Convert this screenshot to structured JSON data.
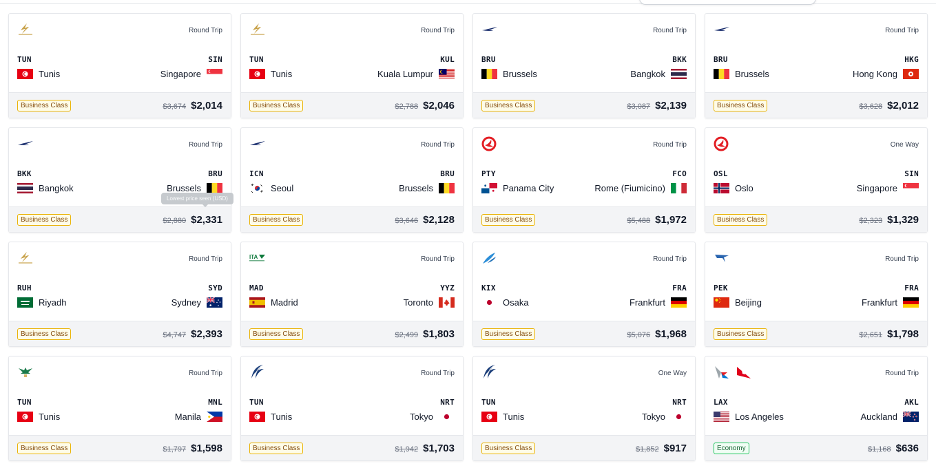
{
  "tooltip": "Lowest price seen (USD)",
  "colors": {
    "business_badge": "#eab308",
    "economy_badge": "#22c55e",
    "footer_bg": "#f3f4f6"
  },
  "cards": [
    {
      "logos": [
        "tunisair-logo"
      ],
      "trip": "Round Trip",
      "from_code": "TUN",
      "to_code": "SIN",
      "from_city": "Tunis",
      "to_city": "Singapore",
      "from_flag": "tn",
      "to_flag": "sg",
      "cabin": "Business Class",
      "cabin_type": "business",
      "old_price": "$3,674",
      "price": "$2,014"
    },
    {
      "logos": [
        "tunisair-logo"
      ],
      "trip": "Round Trip",
      "from_code": "TUN",
      "to_code": "KUL",
      "from_city": "Tunis",
      "to_city": "Kuala Lumpur",
      "from_flag": "tn",
      "to_flag": "my",
      "cabin": "Business Class",
      "cabin_type": "business",
      "old_price": "$2,788",
      "price": "$2,046"
    },
    {
      "logos": [
        "finnair-logo"
      ],
      "trip": "Round Trip",
      "from_code": "BRU",
      "to_code": "BKK",
      "from_city": "Brussels",
      "to_city": "Bangkok",
      "from_flag": "be",
      "to_flag": "th",
      "cabin": "Business Class",
      "cabin_type": "business",
      "old_price": "$3,087",
      "price": "$2,139"
    },
    {
      "logos": [
        "finnair-logo"
      ],
      "trip": "Round Trip",
      "from_code": "BRU",
      "to_code": "HKG",
      "from_city": "Brussels",
      "to_city": "Hong Kong",
      "from_flag": "be",
      "to_flag": "hk",
      "cabin": "Business Class",
      "cabin_type": "business",
      "old_price": "$3,628",
      "price": "$2,012"
    },
    {
      "logos": [
        "finnair-logo"
      ],
      "trip": "Round Trip",
      "from_code": "BKK",
      "to_code": "BRU",
      "from_city": "Bangkok",
      "to_city": "Brussels",
      "from_flag": "th",
      "to_flag": "be",
      "cabin": "Business Class",
      "cabin_type": "business",
      "old_price": "$2,880",
      "price": "$2,331",
      "tooltip": true
    },
    {
      "logos": [
        "finnair-logo"
      ],
      "trip": "Round Trip",
      "from_code": "ICN",
      "to_code": "BRU",
      "from_city": "Seoul",
      "to_city": "Brussels",
      "from_flag": "kr",
      "to_flag": "be",
      "cabin": "Business Class",
      "cabin_type": "business",
      "old_price": "$3,646",
      "price": "$2,128"
    },
    {
      "logos": [
        "turkish-airlines-logo"
      ],
      "trip": "Round Trip",
      "from_code": "PTY",
      "to_code": "FCO",
      "from_city": "Panama City",
      "to_city": "Rome (Fiumicino)",
      "from_flag": "pa",
      "to_flag": "it",
      "cabin": "Business Class",
      "cabin_type": "business",
      "old_price": "$5,488",
      "price": "$1,972"
    },
    {
      "logos": [
        "turkish-airlines-logo"
      ],
      "trip": "One Way",
      "from_code": "OSL",
      "to_code": "SIN",
      "from_city": "Oslo",
      "to_city": "Singapore",
      "from_flag": "no",
      "to_flag": "sg",
      "cabin": "Business Class",
      "cabin_type": "business",
      "old_price": "$2,323",
      "price": "$1,329"
    },
    {
      "logos": [
        "tunisair-logo"
      ],
      "trip": "Round Trip",
      "from_code": "RUH",
      "to_code": "SYD",
      "from_city": "Riyadh",
      "to_city": "Sydney",
      "from_flag": "sa",
      "to_flag": "au",
      "cabin": "Business Class",
      "cabin_type": "business",
      "old_price": "$4,747",
      "price": "$2,393"
    },
    {
      "logos": [
        "ita-airways-logo"
      ],
      "trip": "Round Trip",
      "from_code": "MAD",
      "to_code": "YYZ",
      "from_city": "Madrid",
      "to_city": "Toronto",
      "from_flag": "es",
      "to_flag": "ca",
      "cabin": "Business Class",
      "cabin_type": "business",
      "old_price": "$2,499",
      "price": "$1,803"
    },
    {
      "logos": [
        "china-southern-logo"
      ],
      "trip": "Round Trip",
      "from_code": "KIX",
      "to_code": "FRA",
      "from_city": "Osaka",
      "to_city": "Frankfurt",
      "from_flag": "jp",
      "to_flag": "de",
      "cabin": "Business Class",
      "cabin_type": "business",
      "old_price": "$5,076",
      "price": "$1,968"
    },
    {
      "logos": [
        "air-china-logo"
      ],
      "trip": "Round Trip",
      "from_code": "PEK",
      "to_code": "FRA",
      "from_city": "Beijing",
      "to_city": "Frankfurt",
      "from_flag": "cn",
      "to_flag": "de",
      "cabin": "Business Class",
      "cabin_type": "business",
      "old_price": "$2,651",
      "price": "$1,798"
    },
    {
      "logos": [
        "saudia-logo"
      ],
      "trip": "Round Trip",
      "from_code": "TUN",
      "to_code": "MNL",
      "from_city": "Tunis",
      "to_city": "Manila",
      "from_flag": "tn",
      "to_flag": "ph",
      "cabin": "Business Class",
      "cabin_type": "business",
      "old_price": "$1,797",
      "price": "$1,598"
    },
    {
      "logos": [
        "egyptair-logo"
      ],
      "trip": "Round Trip",
      "from_code": "TUN",
      "to_code": "NRT",
      "from_city": "Tunis",
      "to_city": "Tokyo",
      "from_flag": "tn",
      "to_flag": "jp",
      "cabin": "Business Class",
      "cabin_type": "business",
      "old_price": "$1,942",
      "price": "$1,703"
    },
    {
      "logos": [
        "egyptair-logo"
      ],
      "trip": "One Way",
      "from_code": "TUN",
      "to_code": "NRT",
      "from_city": "Tunis",
      "to_city": "Tokyo",
      "from_flag": "tn",
      "to_flag": "jp",
      "cabin": "Business Class",
      "cabin_type": "business",
      "old_price": "$1,852",
      "price": "$917"
    },
    {
      "logos": [
        "american-airlines-logo",
        "qantas-logo"
      ],
      "trip": "Round Trip",
      "from_code": "LAX",
      "to_code": "AKL",
      "from_city": "Los Angeles",
      "to_city": "Auckland",
      "from_flag": "us",
      "to_flag": "nz",
      "cabin": "Economy",
      "cabin_type": "economy",
      "old_price": "$1,168",
      "price": "$636"
    }
  ]
}
